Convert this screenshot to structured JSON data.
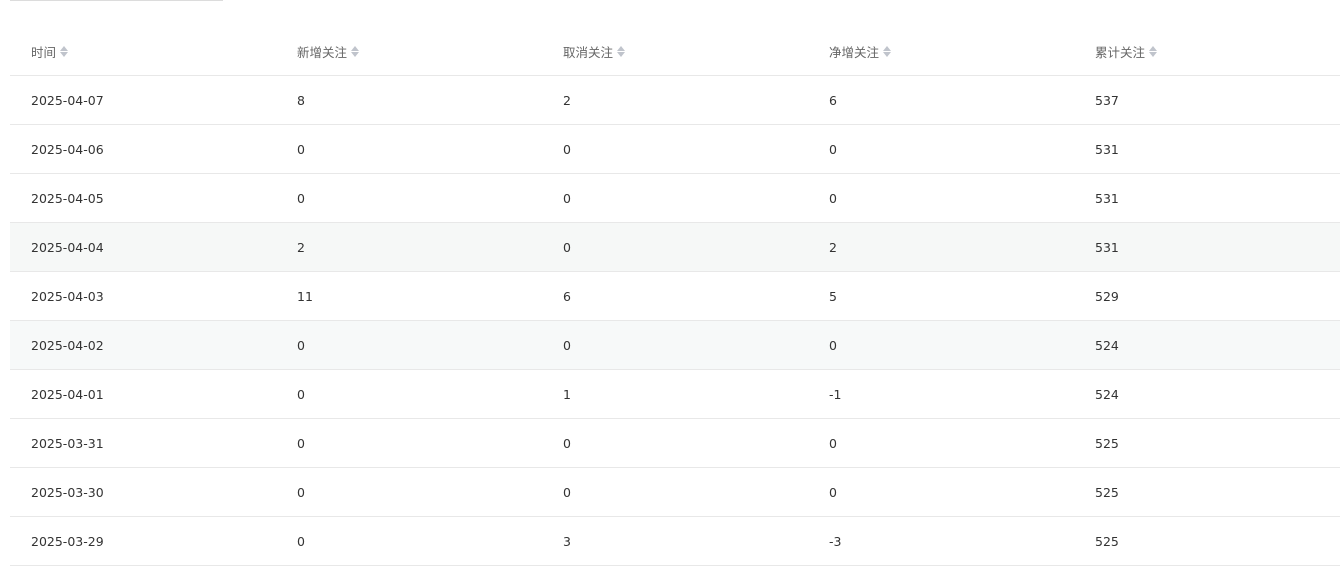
{
  "table": {
    "columns": [
      "时间",
      "新增关注",
      "取消关注",
      "净增关注",
      "累计关注"
    ],
    "rows": [
      [
        "2025-04-07",
        "8",
        "2",
        "6",
        "537"
      ],
      [
        "2025-04-06",
        "0",
        "0",
        "0",
        "531"
      ],
      [
        "2025-04-05",
        "0",
        "0",
        "0",
        "531"
      ],
      [
        "2025-04-04",
        "2",
        "0",
        "2",
        "531"
      ],
      [
        "2025-04-03",
        "11",
        "6",
        "5",
        "529"
      ],
      [
        "2025-04-02",
        "0",
        "0",
        "0",
        "524"
      ],
      [
        "2025-04-01",
        "0",
        "1",
        "-1",
        "524"
      ],
      [
        "2025-03-31",
        "0",
        "0",
        "0",
        "525"
      ],
      [
        "2025-03-30",
        "0",
        "0",
        "0",
        "525"
      ],
      [
        "2025-03-29",
        "0",
        "3",
        "-3",
        "525"
      ]
    ]
  },
  "icons": {
    "sort": "sort-caret-icon"
  }
}
